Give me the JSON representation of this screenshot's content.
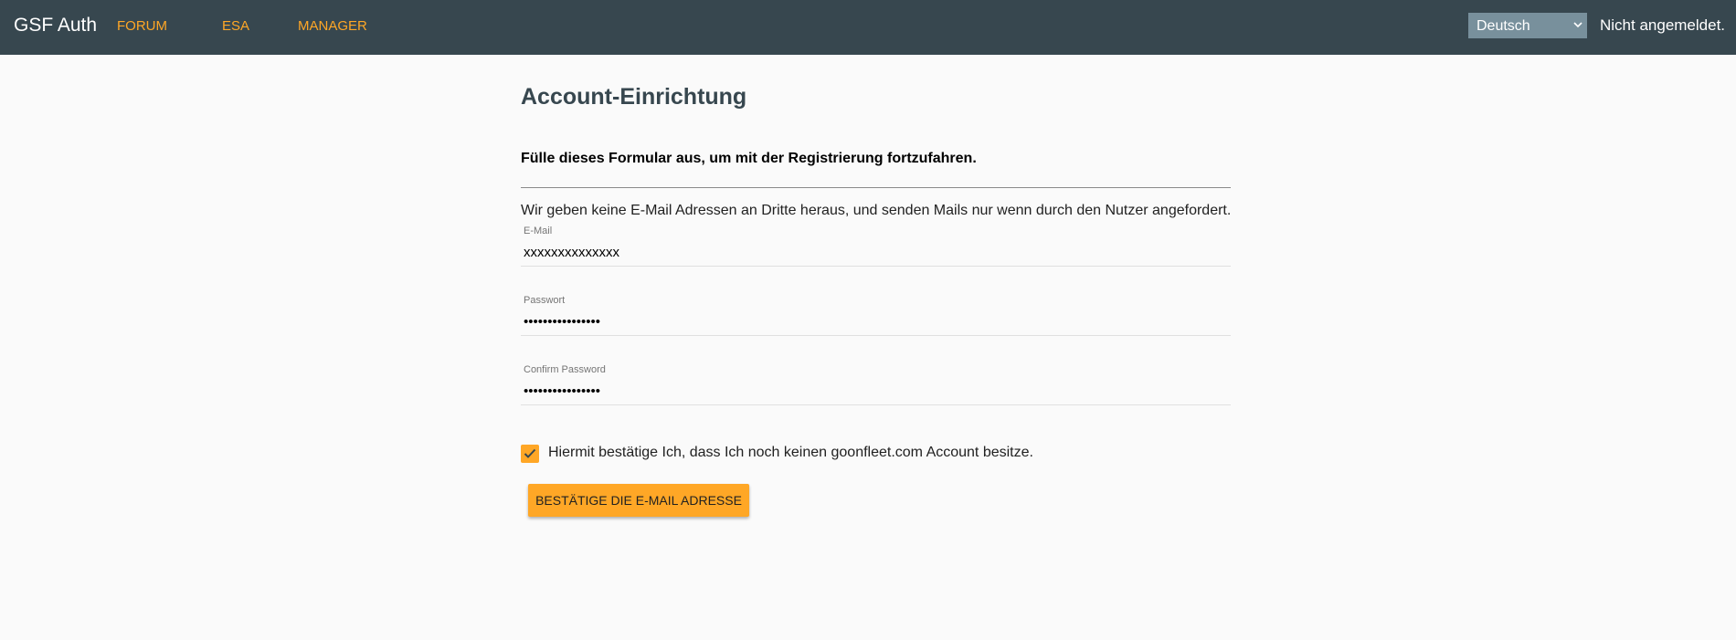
{
  "navbar": {
    "brand": "GSF Auth",
    "links": [
      {
        "label": "FORUM"
      },
      {
        "label": "ESA"
      },
      {
        "label": "MANAGER"
      }
    ],
    "language": {
      "selected": "Deutsch",
      "options": [
        "Deutsch"
      ]
    },
    "login_status": "Nicht angemeldet."
  },
  "form": {
    "title": "Account-Einrichtung",
    "intro": "Fülle dieses Formular aus, um mit der Registrierung fortzufahren.",
    "privacy_note": "Wir geben keine E-Mail Adressen an Dritte heraus, und senden Mails nur wenn durch den Nutzer angefordert.",
    "email": {
      "label": "E-Mail",
      "value": "xxxxxxxxxxxxxx"
    },
    "password": {
      "label": "Passwort",
      "value": "••••••••••••••••"
    },
    "confirm_password": {
      "label": "Confirm Password",
      "value": "••••••••••••••••"
    },
    "confirmation_checkbox": {
      "checked": true,
      "label": "Hiermit bestätige Ich, dass Ich noch keinen goonfleet.com Account besitze."
    },
    "submit_label": "BESTÄTIGE DIE E-MAIL ADRESSE"
  },
  "colors": {
    "navbar_bg": "#37474f",
    "accent": "#ffa726",
    "select_bg": "#78909c",
    "page_bg": "#fafafa",
    "title": "#37474f"
  },
  "icons": {
    "checkbox_mark": "check-icon",
    "select_arrow": "chevron-down-icon"
  }
}
